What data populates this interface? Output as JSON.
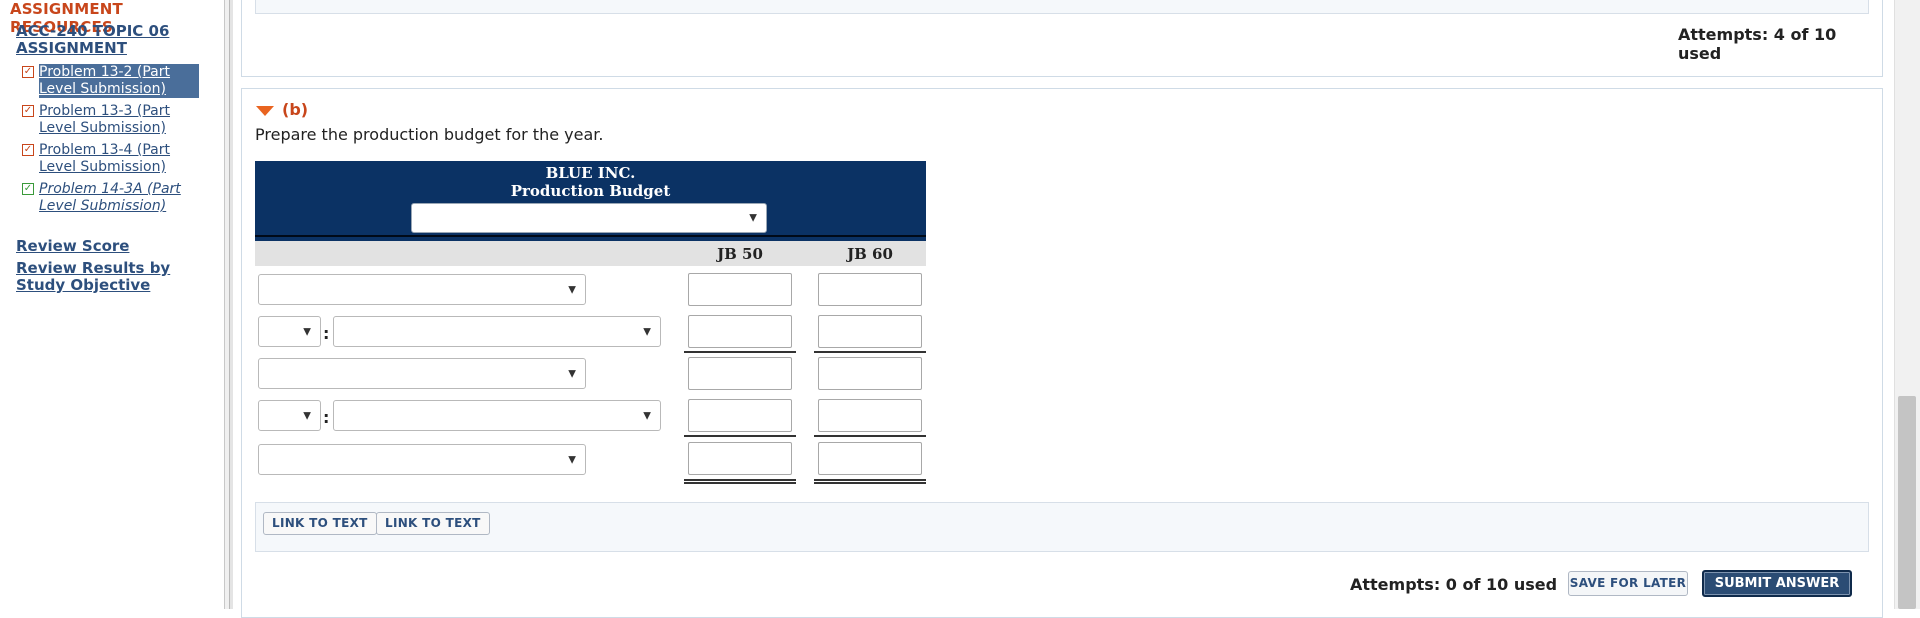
{
  "sidebar": {
    "heading": "ASSIGNMENT RESOURCES",
    "assignment_link": "ACC-240 TOPIC 06 ASSIGNMENT",
    "problems": [
      {
        "label": "Problem 13-2 (Part Level Submission)",
        "status": "incomplete",
        "selected": true
      },
      {
        "label": "Problem 13-3 (Part Level Submission)",
        "status": "incomplete",
        "selected": false
      },
      {
        "label": "Problem 13-4 (Part Level Submission)",
        "status": "incomplete",
        "selected": false
      },
      {
        "label": "Problem 14-3A (Part Level Submission)",
        "status": "complete",
        "selected": false
      }
    ],
    "review_score": "Review Score",
    "review_results": "Review Results by Study Objective"
  },
  "part_a": {
    "attempts": "Attempts: 4 of 10 used"
  },
  "part_b": {
    "label": "(b)",
    "instruction": "Prepare the production budget for the year.",
    "table": {
      "company": "BLUE INC.",
      "title": "Production Budget",
      "period_select": "",
      "columns": [
        "JB 50",
        "JB 60"
      ],
      "rows": [
        {
          "type": "label",
          "label_select": "",
          "values": [
            "",
            ""
          ]
        },
        {
          "type": "operator",
          "operator_select": "",
          "label_select": "",
          "values": [
            "",
            ""
          ]
        },
        {
          "type": "label",
          "label_select": "",
          "values": [
            "",
            ""
          ]
        },
        {
          "type": "operator",
          "operator_select": "",
          "label_select": "",
          "values": [
            "",
            ""
          ]
        },
        {
          "type": "label",
          "label_select": "",
          "values": [
            "",
            ""
          ]
        }
      ]
    },
    "link_buttons": [
      "LINK TO TEXT",
      "LINK TO TEXT"
    ],
    "attempts": "Attempts: 0 of 10 used",
    "save_label": "SAVE FOR LATER",
    "submit_label": "SUBMIT ANSWER"
  },
  "colors": {
    "accent_orange": "#c8461b",
    "link_blue": "#2d4f7d",
    "table_header_navy": "#0b3264",
    "submit_button": "#2b4c74"
  }
}
